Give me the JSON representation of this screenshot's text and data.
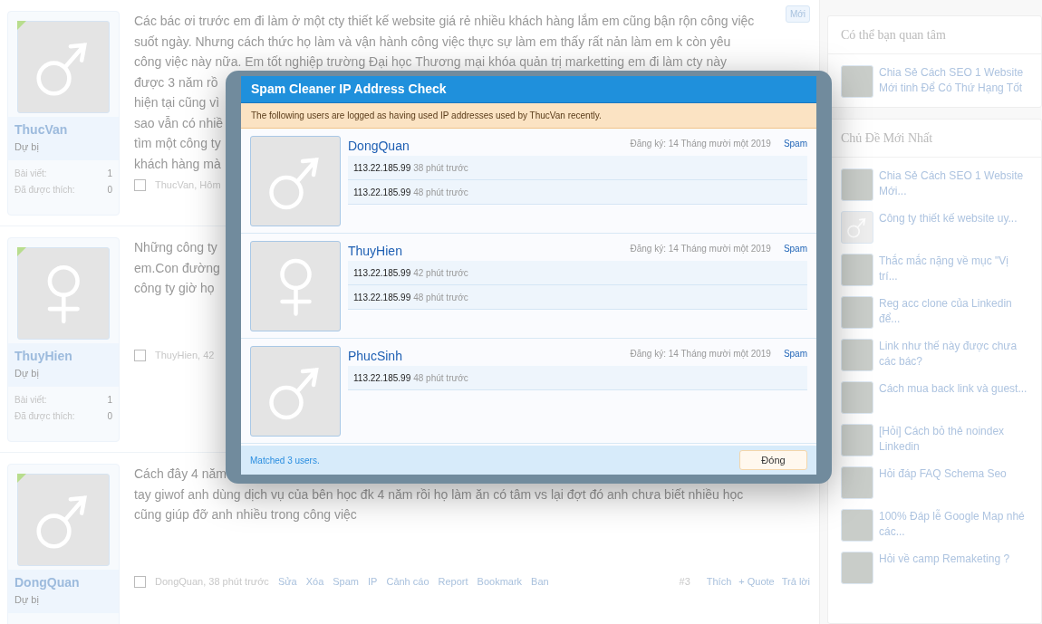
{
  "posts": [
    {
      "user": {
        "name": "ThucVan",
        "rank": "Dự bị",
        "kind": "male",
        "stats": [
          {
            "label": "Bài viết:",
            "value": "1"
          },
          {
            "label": "Đã được thích:",
            "value": "0"
          }
        ]
      },
      "badge": "Mới",
      "lines": [
        "Các bác ơi trước em đi làm ở một cty thiết kế website giá rẻ nhiều khách hàng lắm em cũng bận rộn công việc",
        "suốt ngày. Nhưng cách thức họ làm và vận hành công việc thực sự làm em thấy rất nản làm em k còn yêu",
        "công việc này nữa. Em tốt nghiệp trường Đại học Thương mại khóa quản trị marketting em đi làm cty này",
        "được 3 năm rồ",
        "hiện tại cũng vì",
        "sao vẫn có nhiề",
        "tìm một công ty",
        "khách hàng mà"
      ],
      "checked": false,
      "meta": "ThucVan, Hôm"
    },
    {
      "user": {
        "name": "ThuyHien",
        "rank": "Dự bị",
        "kind": "female",
        "stats": [
          {
            "label": "Bài viết:",
            "value": "1"
          },
          {
            "label": "Đã được thích:",
            "value": "0"
          }
        ]
      },
      "lines": [
        "Những công ty",
        "em.Con đường",
        "công ty giờ họ"
      ],
      "checked": false,
      "meta": "ThuyHien, 42"
    },
    {
      "user": {
        "name": "DongQuan",
        "rank": "Dự bị",
        "kind": "male"
      },
      "lines": [
        "Cách đây 4 năm",
        "tay giwof anh dùng dịch vụ của bên học đk 4 năm rồi họ làm ăn có tâm vs lại đợt đó anh chưa biết nhiều học",
        "cũng giúp đỡ anh nhiều trong công việc"
      ],
      "checked": false,
      "meta": "DongQuan, 38 phút trước",
      "links": [
        "Sửa",
        "Xóa",
        "Spam",
        "IP",
        "Cảnh cáo",
        "Report",
        "Bookmark",
        "Ban"
      ],
      "number": "#3",
      "actions": [
        "Thích",
        "+ Quote",
        "Trả lời"
      ]
    }
  ],
  "sidebar": [
    {
      "title": "Có thể bạn quan tâm",
      "items": [
        {
          "kind": "photo",
          "title": "Chia Sẻ Cách SEO 1 Website Mới tinh Để Có Thứ Hạng Tốt"
        }
      ]
    },
    {
      "title": "Chủ Đề Mới Nhất",
      "items": [
        {
          "kind": "photo",
          "title": "Chia Sẻ Cách SEO 1 Website Mới..."
        },
        {
          "kind": "male",
          "title": "Công ty thiết kế website uy..."
        },
        {
          "kind": "photo",
          "title": "Thắc mắc nặng về mục \"Vị trí..."
        },
        {
          "kind": "photo",
          "title": "Reg acc clone của Linkedin để..."
        },
        {
          "kind": "photo",
          "title": "Link như thế này được chưa các bác?"
        },
        {
          "kind": "photo",
          "title": "Cách mua back link và guest..."
        },
        {
          "kind": "photo",
          "title": "[Hỏi] Cách bỏ thẻ noindex Linkedin"
        },
        {
          "kind": "photo",
          "title": "Hỏi đáp FAQ Schema Seo"
        },
        {
          "kind": "photo",
          "title": "100% Đáp lễ Google Map nhé các..."
        },
        {
          "kind": "photo",
          "title": "Hỏi về camp Remaketing ?"
        }
      ]
    }
  ],
  "dialog": {
    "title": "Spam Cleaner IP Address Check",
    "notice": "The following users are logged as having used IP addresses used by ThucVan recently.",
    "users": [
      {
        "name": "DongQuan",
        "kind": "male",
        "registered": "Đăng ký: 14 Tháng mười một 2019",
        "action": "Spam",
        "ips": [
          {
            "ip": "113.22.185.99",
            "time": "38 phút trước"
          },
          {
            "ip": "113.22.185.99",
            "time": "48 phút trước"
          }
        ]
      },
      {
        "name": "ThuyHien",
        "kind": "female",
        "registered": "Đăng ký: 14 Tháng mười một 2019",
        "action": "Spam",
        "ips": [
          {
            "ip": "113.22.185.99",
            "time": "42 phút trước"
          },
          {
            "ip": "113.22.185.99",
            "time": "48 phút trước"
          }
        ]
      },
      {
        "name": "PhucSinh",
        "kind": "male",
        "registered": "Đăng ký: 14 Tháng mười một 2019",
        "action": "Spam",
        "ips": [
          {
            "ip": "113.22.185.99",
            "time": "48 phút trước"
          }
        ]
      }
    ],
    "footer": "Matched 3 users.",
    "button": "Đóng"
  }
}
